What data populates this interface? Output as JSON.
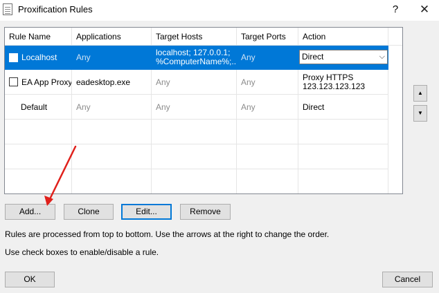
{
  "window": {
    "title": "Proxification Rules",
    "help_label": "?",
    "close_label": "✕",
    "icon": "document-icon"
  },
  "table": {
    "columns": [
      "Rule Name",
      "Applications",
      "Target Hosts",
      "Target Ports",
      "Action"
    ],
    "rows": [
      {
        "name": "Localhost",
        "checkbox": true,
        "checked": false,
        "selected": true,
        "applications": "Any",
        "target_hosts_line1": "localhost; 127.0.0.1;",
        "target_hosts_line2": "%ComputerName%;...",
        "target_ports": "Any",
        "action": "Direct",
        "action_arrow": "⌵"
      },
      {
        "name": "EA App Proxy",
        "checkbox": true,
        "checked": false,
        "selected": false,
        "applications": "eadesktop.exe",
        "target_hosts": "Any",
        "target_ports": "Any",
        "action_line1": "Proxy HTTPS",
        "action_line2": "123.123.123.123"
      },
      {
        "name": "Default",
        "checkbox": false,
        "selected": false,
        "applications": "Any",
        "target_hosts": "Any",
        "target_ports": "Any",
        "action": "Direct"
      }
    ]
  },
  "order_buttons": {
    "up_label": "▲",
    "down_label": "▼"
  },
  "buttons": {
    "add": "Add...",
    "clone": "Clone",
    "edit": "Edit...",
    "remove": "Remove",
    "ok": "OK",
    "cancel": "Cancel"
  },
  "info": {
    "order_text": "Rules are processed from top to bottom. Use the arrows at the right to change the order.",
    "checkbox_text": "Use check boxes to enable/disable a rule."
  },
  "colors": {
    "selection": "#0078d7",
    "annotation_arrow": "#e0201b",
    "default_button_border": "#0078d7"
  }
}
